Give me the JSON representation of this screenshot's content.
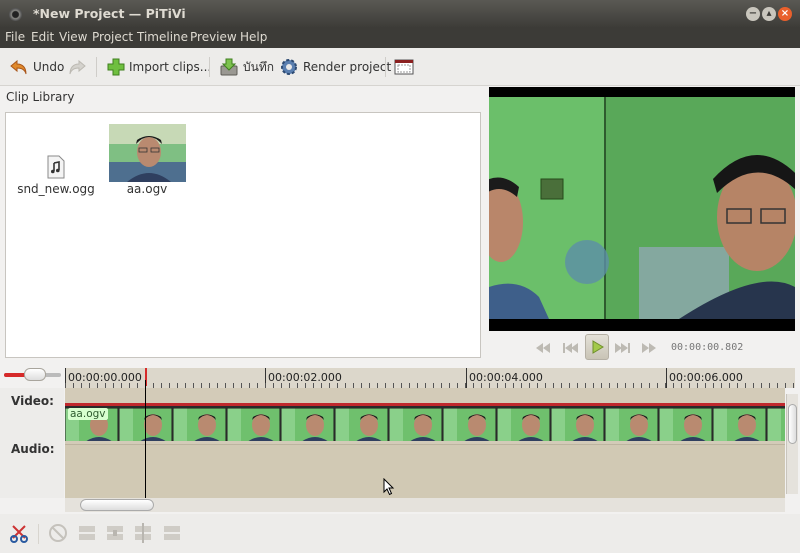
{
  "window": {
    "title": "*New Project — PiTiVi"
  },
  "menu": [
    "File",
    "Edit",
    "View",
    "Project",
    "Timeline",
    "Preview",
    "Help"
  ],
  "toolbar": {
    "undo": "Undo",
    "import": "Import clips...",
    "save": "บันทึก",
    "render": "Render project"
  },
  "clip_library": {
    "title": "Clip Library",
    "items": [
      {
        "name": "snd_new.ogg",
        "icon": "audio-file-icon"
      },
      {
        "name": "aa.ogv",
        "icon": "video-thumbnail"
      }
    ]
  },
  "viewer": {
    "timecode": "00:00:00.802"
  },
  "timeline": {
    "ruler_labels": [
      "00:00:00.000",
      "00:00:02.000",
      "00:00:04.000",
      "00:00:06.000"
    ],
    "tracks": {
      "video": "Video:",
      "audio": "Audio:"
    },
    "clip_name": "aa.ogv"
  },
  "colors": {
    "accent": "#d62a2a",
    "close": "#e9602c",
    "clip_label_bg": "#d8ffcf"
  }
}
